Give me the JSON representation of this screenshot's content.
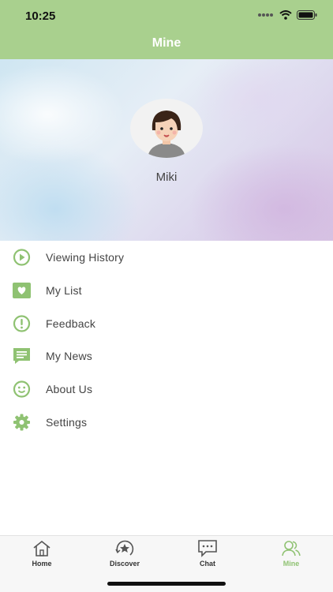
{
  "status": {
    "time": "10:25"
  },
  "nav": {
    "title": "Mine"
  },
  "profile": {
    "name": "Miki"
  },
  "menu": [
    {
      "label": "Viewing History",
      "icon": "play-circle-icon"
    },
    {
      "label": "My List",
      "icon": "heart-icon"
    },
    {
      "label": "Feedback",
      "icon": "exclamation-circle-icon"
    },
    {
      "label": "My News",
      "icon": "news-icon"
    },
    {
      "label": "About Us",
      "icon": "smiley-icon"
    },
    {
      "label": "Settings",
      "icon": "gear-icon"
    }
  ],
  "tabs": [
    {
      "label": "Home",
      "icon": "home-icon"
    },
    {
      "label": "Discover",
      "icon": "discover-star-icon"
    },
    {
      "label": "Chat",
      "icon": "chat-bubble-icon"
    },
    {
      "label": "Mine",
      "icon": "people-icon"
    }
  ],
  "colors": {
    "accent": "#a9d08e",
    "icon": "#8fc272",
    "text": "#444444"
  }
}
